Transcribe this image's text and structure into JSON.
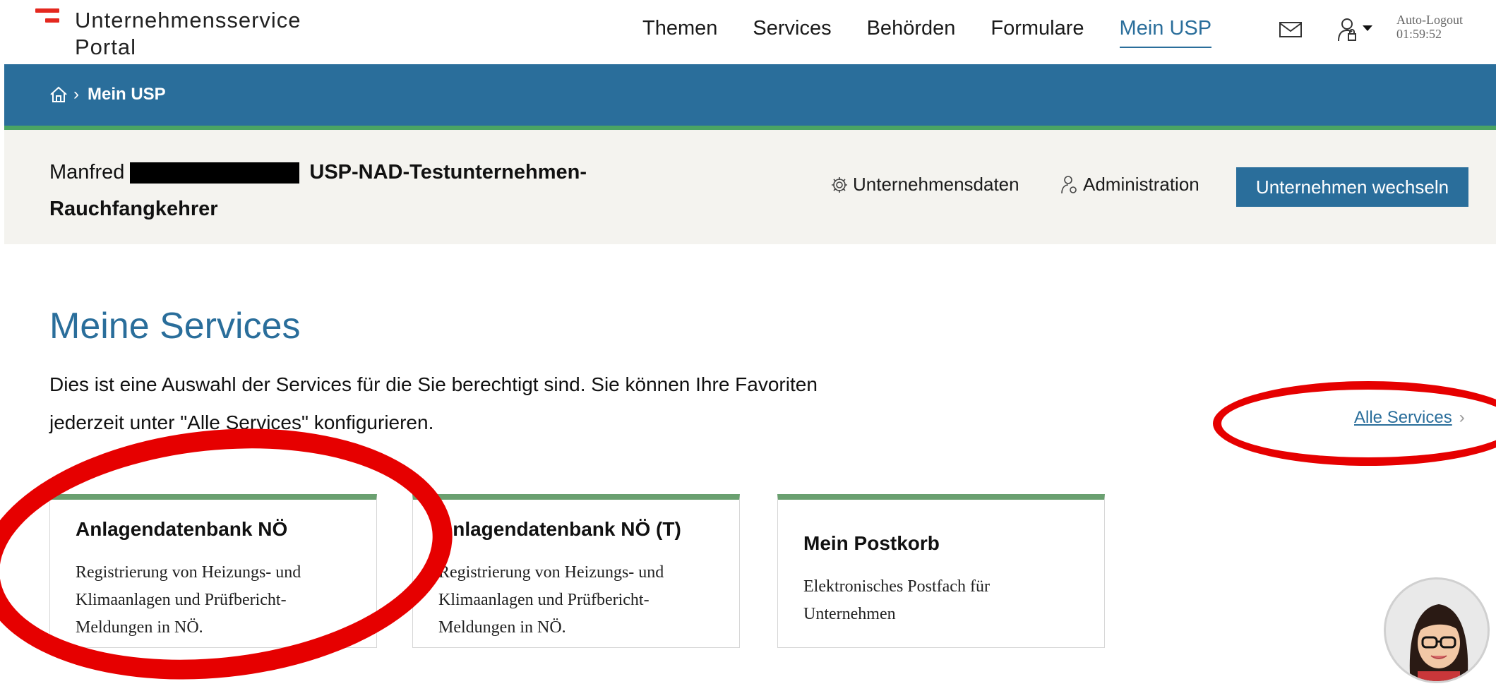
{
  "header": {
    "logo_line1": "Unternehmensservice",
    "logo_line2": "Portal",
    "nav": [
      {
        "label": "Themen"
      },
      {
        "label": "Services"
      },
      {
        "label": "Behörden"
      },
      {
        "label": "Formulare"
      },
      {
        "label": "Mein USP"
      }
    ],
    "active_nav": "Mein USP",
    "mail_icon": "envelope-icon",
    "user_icon": "user-lock-icon",
    "autologout_label": "Auto-Logout",
    "autologout_time": "01:59:52"
  },
  "breadcrumb": {
    "home_icon": "home-icon",
    "current": "Mein USP"
  },
  "company": {
    "first_name": "Manfred",
    "company_name_part1": "USP-NAD-Testunternehmen-",
    "company_name_part2": "Rauchfangkehrer",
    "link_data": "Unternehmensdaten",
    "link_admin": "Administration",
    "switch_button": "Unternehmen wechseln"
  },
  "main": {
    "title": "Meine Services",
    "intro_line1": "Dies ist eine Auswahl der Services für die Sie berechtigt sind. Sie können Ihre Favoriten",
    "intro_line2": "jederzeit unter \"Alle Services\" konfigurieren.",
    "all_services_link": "Alle Services",
    "cards": [
      {
        "title": "Anlagendatenbank NÖ",
        "line1": "Registrierung von Heizungs- und",
        "line2": "Klimaanlagen und Prüfbericht-",
        "line3": "Meldungen in NÖ."
      },
      {
        "title": "Anlagendatenbank NÖ (T)",
        "line1": "Registrierung von Heizungs- und",
        "line2": "Klimaanlagen und Prüfbericht-",
        "line3": "Meldungen in NÖ."
      },
      {
        "title": "Mein Postkorb",
        "line1": "Elektronisches Postfach für",
        "line2": "Unternehmen"
      }
    ]
  },
  "colors": {
    "primary_blue": "#2a6e9b",
    "accent_green": "#6aa070",
    "logo_red": "#e4281f",
    "annotation_red": "#e60000"
  }
}
